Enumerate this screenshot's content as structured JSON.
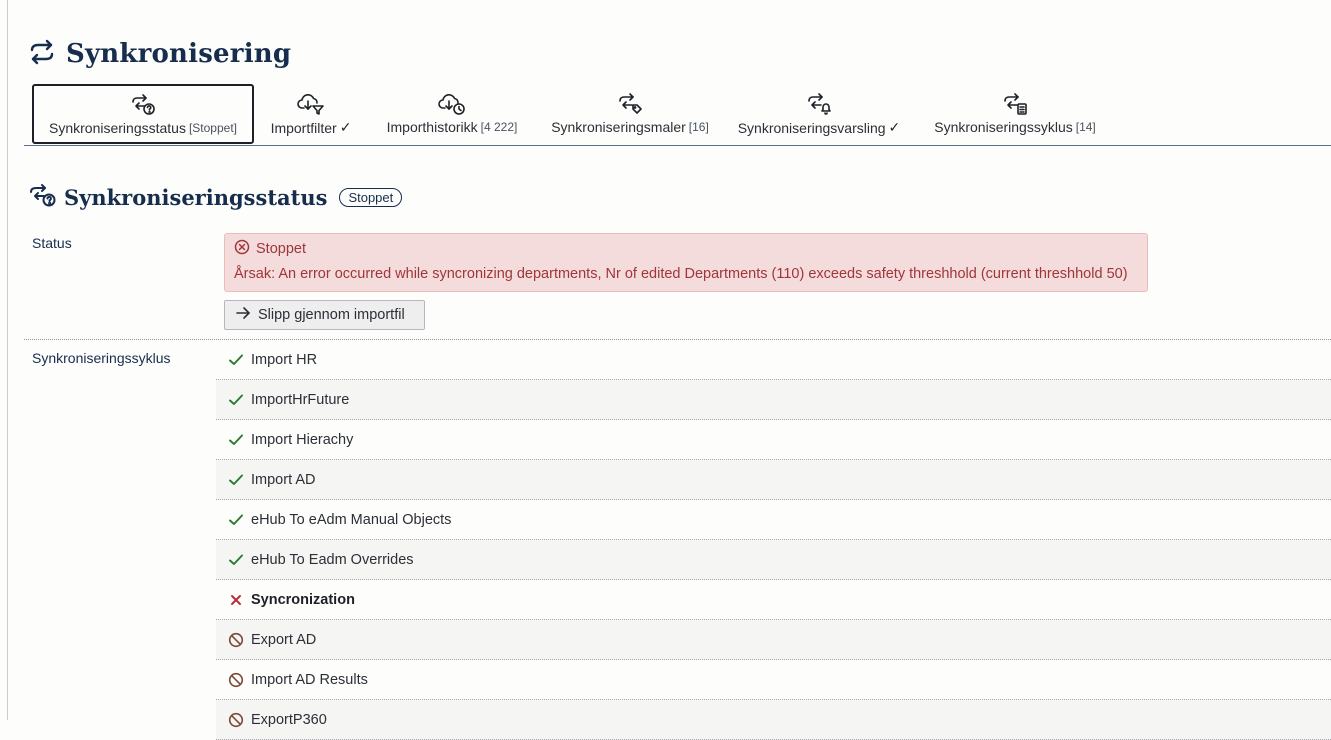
{
  "page": {
    "title": "Synkronisering"
  },
  "tabs": [
    {
      "label": "Synkroniseringsstatus",
      "count": "[Stoppet]",
      "check": "",
      "active": true,
      "icon": "sync-question-icon"
    },
    {
      "label": "Importfilter",
      "count": "",
      "check": "✓",
      "active": false,
      "icon": "cloud-download-filter-icon"
    },
    {
      "label": "Importhistorikk",
      "count": "[4 222]",
      "check": "",
      "active": false,
      "icon": "cloud-download-clock-icon"
    },
    {
      "label": "Synkroniseringsmaler",
      "count": "[16]",
      "check": "",
      "active": false,
      "icon": "sync-tag-icon"
    },
    {
      "label": "Synkroniseringsvarsling",
      "count": "",
      "check": "✓",
      "active": false,
      "icon": "sync-bell-icon"
    },
    {
      "label": "Synkroniseringssyklus",
      "count": "[14]",
      "check": "",
      "active": false,
      "icon": "sync-list-icon"
    }
  ],
  "section": {
    "title": "Synkroniseringsstatus",
    "badge": "Stoppet"
  },
  "status": {
    "label": "Status",
    "alert_title": "Stoppet",
    "alert_message": "Årsak: An error occurred while syncronizing departments, Nr of edited Departments (110) exceeds safety threshhold (current threshhold 50)",
    "button_label": "Slipp gjennom importfil"
  },
  "cycle": {
    "label": "Synkroniseringssyklus",
    "steps": [
      {
        "label": "Import HR",
        "state": "done"
      },
      {
        "label": "ImportHrFuture",
        "state": "done"
      },
      {
        "label": "Import Hierachy",
        "state": "done"
      },
      {
        "label": "Import AD",
        "state": "done"
      },
      {
        "label": "eHub To eAdm Manual Objects",
        "state": "done"
      },
      {
        "label": "eHub To Eadm Overrides",
        "state": "done"
      },
      {
        "label": "Syncronization",
        "state": "failed"
      },
      {
        "label": "Export AD",
        "state": "blocked"
      },
      {
        "label": "Import AD Results",
        "state": "blocked"
      },
      {
        "label": "ExportP360",
        "state": "blocked"
      }
    ]
  },
  "colors": {
    "heading": "#172d4d",
    "success": "#2e7d32",
    "error": "#b3303a",
    "blocked": "#7a4a3a",
    "alert_bg": "#f4dcdc"
  }
}
